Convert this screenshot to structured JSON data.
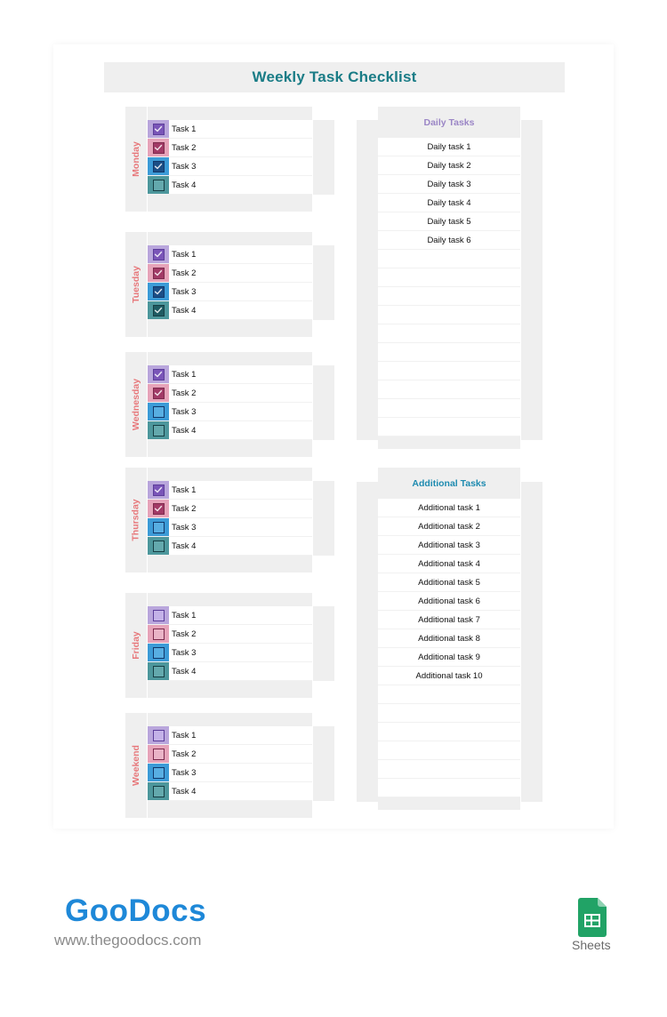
{
  "document": {
    "title": "Weekly Task Checklist"
  },
  "colors": {
    "title": "#1a7c86",
    "day_label": "#e7777a",
    "daily_header": "#9b86c6",
    "additional_header": "#1e8bb0",
    "checkbox_styles": [
      {
        "bg": "#b9a6dc",
        "fill": "#7a55b8",
        "border": "#5c3e9a",
        "empty_fill": "#c4b2e8"
      },
      {
        "bg": "#e6a3b9",
        "fill": "#a23a66",
        "border": "#7c2a4c",
        "empty_fill": "#eab3c6"
      },
      {
        "bg": "#3c9bd7",
        "fill": "#1b4e86",
        "border": "#12386a",
        "empty_fill": "#58aee2"
      },
      {
        "bg": "#4d979c",
        "fill": "#1f5b62",
        "border": "#173f45",
        "empty_fill": "#64a9ad"
      }
    ]
  },
  "days": [
    {
      "name": "Monday",
      "tasks": [
        {
          "label": "Task 1",
          "checked": true
        },
        {
          "label": "Task 2",
          "checked": true
        },
        {
          "label": "Task 3",
          "checked": true
        },
        {
          "label": "Task 4",
          "checked": false
        }
      ]
    },
    {
      "name": "Tuesday",
      "tasks": [
        {
          "label": "Task 1",
          "checked": true
        },
        {
          "label": "Task 2",
          "checked": true
        },
        {
          "label": "Task 3",
          "checked": true
        },
        {
          "label": "Task 4",
          "checked": true
        }
      ]
    },
    {
      "name": "Wednesday",
      "tasks": [
        {
          "label": "Task 1",
          "checked": true
        },
        {
          "label": "Task 2",
          "checked": true
        },
        {
          "label": "Task 3",
          "checked": false
        },
        {
          "label": "Task 4",
          "checked": false
        }
      ]
    },
    {
      "name": "Thursday",
      "tasks": [
        {
          "label": "Task 1",
          "checked": true
        },
        {
          "label": "Task 2",
          "checked": true
        },
        {
          "label": "Task 3",
          "checked": false
        },
        {
          "label": "Task 4",
          "checked": false
        }
      ]
    },
    {
      "name": "Friday",
      "tasks": [
        {
          "label": "Task 1",
          "checked": false
        },
        {
          "label": "Task 2",
          "checked": false
        },
        {
          "label": "Task 3",
          "checked": false
        },
        {
          "label": "Task 4",
          "checked": false
        }
      ]
    },
    {
      "name": "Weekend",
      "tasks": [
        {
          "label": "Task 1",
          "checked": false
        },
        {
          "label": "Task 2",
          "checked": false
        },
        {
          "label": "Task 3",
          "checked": false
        },
        {
          "label": "Task 4",
          "checked": false
        }
      ]
    }
  ],
  "daily_tasks": {
    "header": "Daily Tasks",
    "items": [
      "Daily task 1",
      "Daily task 2",
      "Daily task 3",
      "Daily task 4",
      "Daily task 5",
      "Daily task 6",
      "",
      "",
      "",
      "",
      "",
      "",
      "",
      "",
      "",
      ""
    ]
  },
  "additional_tasks": {
    "header": "Additional Tasks",
    "items": [
      "Additional task 1",
      "Additional task 2",
      "Additional task 3",
      "Additional task 4",
      "Additional task 5",
      "Additional task 6",
      "Additional task 7",
      "Additional task 8",
      "Additional task 9",
      "Additional task 10",
      "",
      "",
      "",
      "",
      "",
      ""
    ]
  },
  "footer": {
    "brand": "GooDocs",
    "url": "www.thegoodocs.com",
    "app_label": "Sheets"
  }
}
